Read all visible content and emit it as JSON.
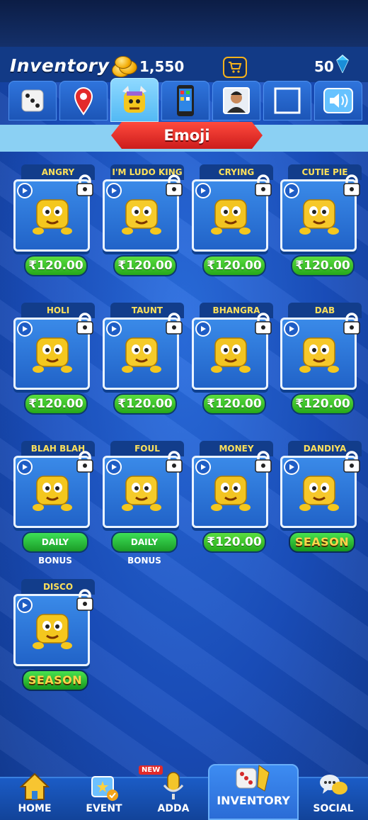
{
  "header": {
    "title": "Inventory",
    "coins": "1,550",
    "gems": "50"
  },
  "icons": {
    "coin": "coin-stack-icon",
    "cart": "cart-icon",
    "gem": "gem-icon"
  },
  "tabs": [
    "dice-icon",
    "pin-icon",
    "emoji-icon",
    "phone-icon",
    "avatar-icon",
    "frame-icon",
    "sound-icon"
  ],
  "section": {
    "title": "Emoji"
  },
  "emojis": [
    {
      "name": "ANGRY",
      "price": "₹120.00"
    },
    {
      "name": "I'M LUDO KING",
      "price": "₹120.00"
    },
    {
      "name": "CRYING",
      "price": "₹120.00"
    },
    {
      "name": "CUTIE PIE",
      "price": "₹120.00"
    },
    {
      "name": "HOLI",
      "price": "₹120.00"
    },
    {
      "name": "TAUNT",
      "price": "₹120.00"
    },
    {
      "name": "BHANGRA",
      "price": "₹120.00"
    },
    {
      "name": "DAB",
      "price": "₹120.00"
    },
    {
      "name": "BLAH BLAH",
      "price": "DAILY BONUS"
    },
    {
      "name": "FOUL",
      "price": "DAILY BONUS"
    },
    {
      "name": "MONEY",
      "price": "₹120.00"
    },
    {
      "name": "DANDIYA",
      "price": "SEASON"
    },
    {
      "name": "DISCO",
      "price": "SEASON"
    }
  ],
  "nav": {
    "home": "HOME",
    "event": "EVENT",
    "adda": "ADDA",
    "new_badge": "NEW",
    "inventory": "INVENTORY",
    "social": "SOCIAL"
  },
  "colors": {
    "accent": "#1b55c4",
    "price_green": "#3ac52a",
    "label_yellow": "#fde05a",
    "banner_red": "#e02626"
  }
}
